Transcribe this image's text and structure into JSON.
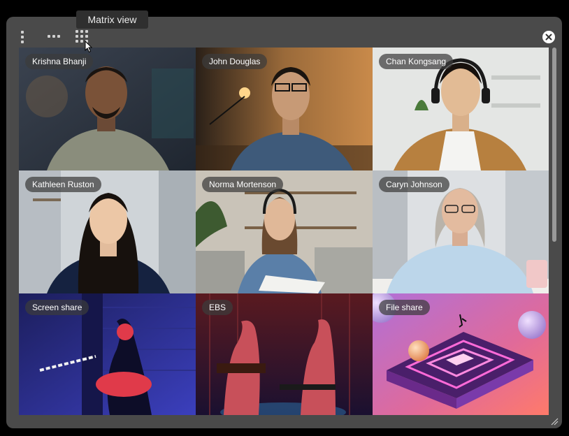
{
  "toolbar": {
    "tooltip": "Matrix view",
    "icons": [
      "vertical-view-icon",
      "horizontal-view-icon",
      "matrix-view-icon",
      "close-icon",
      "resize-grip-icon"
    ]
  },
  "tiles": [
    {
      "label": "Krishna Bhanji"
    },
    {
      "label": "John Douglas"
    },
    {
      "label": "Chan Kongsang"
    },
    {
      "label": "Kathleen Ruston"
    },
    {
      "label": "Norma Mortenson"
    },
    {
      "label": "Caryn Johnson"
    },
    {
      "label": "Screen share"
    },
    {
      "label": "EBS"
    },
    {
      "label": "File share"
    }
  ],
  "colors": {
    "window": "#4a4a4a",
    "background": "#000000",
    "label_bg": "#3c3c3c"
  }
}
